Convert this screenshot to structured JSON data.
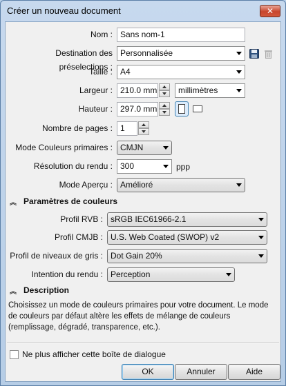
{
  "window": {
    "title": "Créer un nouveau document",
    "close_glyph": "✕"
  },
  "form": {
    "nom": {
      "label": "Nom :",
      "value": "Sans nom-1"
    },
    "destination": {
      "label": "Destination des préselections :",
      "value": "Personnalisée"
    },
    "taille": {
      "label": "Taille :",
      "value": "A4"
    },
    "largeur": {
      "label": "Largeur :",
      "value": "210.0 mm",
      "unit": "millimètres"
    },
    "hauteur": {
      "label": "Hauteur :",
      "value": "297.0 mm"
    },
    "pages": {
      "label": "Nombre de pages :",
      "value": "1"
    },
    "couleurs": {
      "label": "Mode Couleurs primaires :",
      "value": "CMJN"
    },
    "resolution": {
      "label": "Résolution du rendu :",
      "value": "300",
      "unit": "ppp"
    },
    "apercu": {
      "label": "Mode Aperçu :",
      "value": "Amélioré"
    }
  },
  "color_section": {
    "title": "Paramètres de couleurs",
    "rvb": {
      "label": "Profil RVB :",
      "value": "sRGB IEC61966-2.1"
    },
    "cmjb": {
      "label": "Profil CMJB :",
      "value": "U.S. Web Coated (SWOP) v2"
    },
    "gris": {
      "label": "Profil de niveaux de gris :",
      "value": "Dot Gain 20%"
    },
    "intention": {
      "label": "Intention du rendu :",
      "value": "Perception"
    }
  },
  "description": {
    "title": "Description",
    "text": "Choisissez un mode de couleurs primaires pour votre document. Le mode de couleurs par défaut altère les effets de mélange de couleurs (remplissage, dégradé, transparence, etc.)."
  },
  "footer": {
    "checkbox_label": "Ne plus afficher cette boîte de dialogue",
    "ok": "OK",
    "cancel": "Annuler",
    "help": "Aide"
  },
  "icons": {
    "save": "save-icon",
    "delete": "trash-icon",
    "portrait": "portrait-page-icon",
    "landscape": "landscape-page-icon",
    "collapse": "chevron-collapse-icon"
  },
  "colors": {
    "titlebar": "#c7d9ee",
    "close": "#c8452c",
    "client": "#f0f0f0"
  }
}
